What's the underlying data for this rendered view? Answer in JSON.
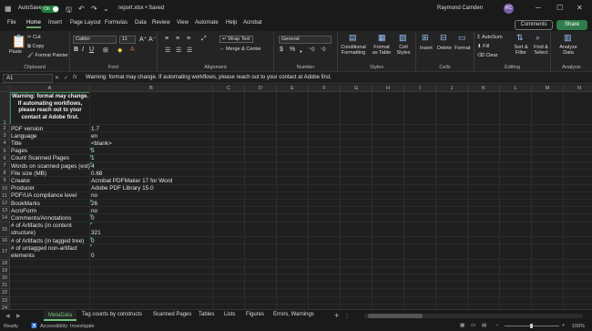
{
  "titlebar": {
    "autosave_label": "AutoSave",
    "autosave_state": "On",
    "filename": "report.xlsx • Saved",
    "user_name": "Raymond Camden",
    "user_initials": "RC"
  },
  "ribbon_tabs": [
    "File",
    "Home",
    "Insert",
    "Page Layout",
    "Formulas",
    "Data",
    "Review",
    "View",
    "Automate",
    "Help",
    "Acrobat"
  ],
  "actions": {
    "comments": "Comments",
    "share": "Share"
  },
  "ribbon": {
    "clipboard": {
      "paste": "Paste",
      "cut": "Cut",
      "copy": "Copy",
      "format_painter": "Format Painter",
      "label": "Clipboard"
    },
    "font": {
      "name": "Calibri",
      "size": "11",
      "label": "Font"
    },
    "alignment": {
      "wrap_text": "Wrap Text",
      "merge": "Merge & Center",
      "label": "Alignment"
    },
    "number": {
      "format": "General",
      "label": "Number"
    },
    "styles": {
      "conditional": "Conditional Formatting",
      "format_table": "Format as Table",
      "cell_styles": "Cell Styles",
      "label": "Styles"
    },
    "cells": {
      "insert": "Insert",
      "delete": "Delete",
      "format": "Format",
      "label": "Cells"
    },
    "editing": {
      "autosum": "AutoSum",
      "fill": "Fill",
      "clear": "Clear",
      "sort": "Sort & Filter",
      "find": "Find & Select",
      "label": "Editing"
    },
    "analysis": {
      "analyze": "Analyze Data",
      "label": "Analysis"
    }
  },
  "formula_bar": {
    "cell_ref": "A1",
    "fx": "fx",
    "content": "Warning: format may change. If automating workflows, please reach out to your contact at Adobe first."
  },
  "columns": [
    "A",
    "B",
    "C",
    "D",
    "E",
    "F",
    "G",
    "H",
    "I",
    "J",
    "K",
    "L",
    "M",
    "N",
    "O",
    "P",
    "Q"
  ],
  "warning_cell": "Warning: format may change. If automating workflows, please reach out to your contact at Adobe first.",
  "rows": [
    {
      "n": "1",
      "a": "",
      "b": ""
    },
    {
      "n": "2",
      "a": "PDF version",
      "b": "1.7"
    },
    {
      "n": "3",
      "a": "Language",
      "b": "en"
    },
    {
      "n": "4",
      "a": "Title",
      "b": "<blank>"
    },
    {
      "n": "5",
      "a": "Pages",
      "b": "5"
    },
    {
      "n": "6",
      "a": "Count Scanned Pages",
      "b": "1"
    },
    {
      "n": "7",
      "a": "Words on scanned pages (est)",
      "b": "4"
    },
    {
      "n": "8",
      "a": "File size (MB)",
      "b": "0.68"
    },
    {
      "n": "9",
      "a": "Creator",
      "b": "Acrobat PDFMaker 17 for Word"
    },
    {
      "n": "10",
      "a": "Producer",
      "b": "Adobe PDF Library 15.0"
    },
    {
      "n": "11",
      "a": "PDF/UA compliance level",
      "b": "no"
    },
    {
      "n": "12",
      "a": "BookMarks",
      "b": "26"
    },
    {
      "n": "13",
      "a": "AcroForm",
      "b": "no"
    },
    {
      "n": "14",
      "a": "Comments/Annotations",
      "b": "0"
    },
    {
      "n": "15",
      "a": "# of Artifacts (in content",
      "a2": "structure)",
      "b": "321"
    },
    {
      "n": "16",
      "a": "# of Artifacts (in tagged tree)",
      "b": "0"
    },
    {
      "n": "17",
      "a": "# of untagged non-artifact",
      "a2": "elements",
      "b": "0"
    },
    {
      "n": "18",
      "a": "",
      "b": ""
    },
    {
      "n": "19",
      "a": "",
      "b": ""
    },
    {
      "n": "20",
      "a": "",
      "b": ""
    },
    {
      "n": "21",
      "a": "",
      "b": ""
    },
    {
      "n": "22",
      "a": "",
      "b": ""
    },
    {
      "n": "23",
      "a": "",
      "b": ""
    },
    {
      "n": "24",
      "a": "",
      "b": ""
    },
    {
      "n": "25",
      "a": "",
      "b": ""
    },
    {
      "n": "26",
      "a": "",
      "b": ""
    },
    {
      "n": "27",
      "a": "",
      "b": ""
    },
    {
      "n": "28",
      "a": "",
      "b": ""
    }
  ],
  "sheet_tabs": [
    "MetaData",
    "Tag counts by constructs",
    "Scanned Pages",
    "Tables",
    "Lists",
    "Figures",
    "Errors, Warnings"
  ],
  "add_sheet": "+",
  "status": {
    "ready": "Ready",
    "accessibility": "Accessibility: Investigate",
    "zoom": "100%"
  },
  "colors": {
    "accent": "#6ec47d",
    "share": "#2f7d4a",
    "selection": "#2e8b4e"
  }
}
